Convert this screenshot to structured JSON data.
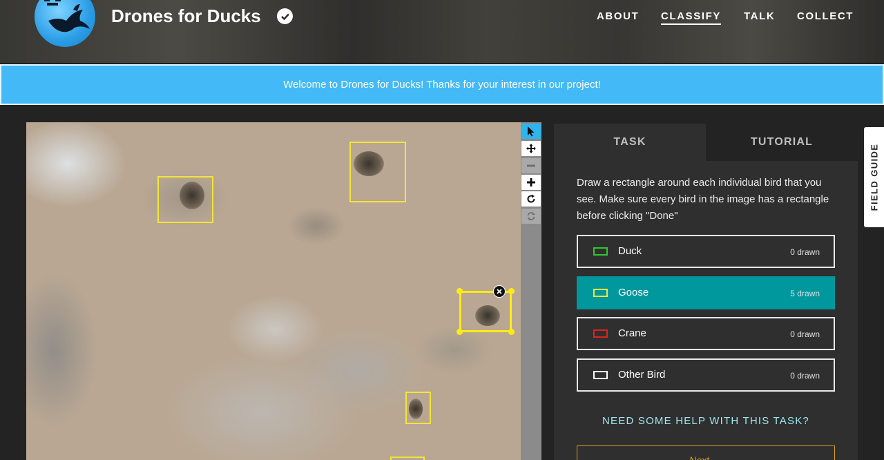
{
  "header": {
    "project_title": "Drones for Ducks",
    "verified_icon": "check-badge-icon",
    "nav": [
      {
        "label": "ABOUT"
      },
      {
        "label": "CLASSIFY",
        "active": true
      },
      {
        "label": "TALK"
      },
      {
        "label": "COLLECT"
      }
    ]
  },
  "banner": {
    "text": "Welcome to Drones for Ducks! Thanks for your interest in our project!"
  },
  "toolbar": {
    "tools": [
      "pointer-icon",
      "pan-icon",
      "zoom-out-icon",
      "zoom-in-icon",
      "rotate-icon",
      "reset-icon"
    ]
  },
  "task_panel": {
    "tabs": [
      {
        "label": "TASK"
      },
      {
        "label": "TUTORIAL"
      }
    ],
    "instruction": "Draw a rectangle around each individual bird that you see. Make sure every bird in the image has a rectangle before clicking \"Done\"",
    "choices": [
      {
        "label": "Duck",
        "count": "0 drawn",
        "color": "#2ec82e"
      },
      {
        "label": "Goose",
        "count": "5 drawn",
        "color": "#f3e53a",
        "active": true
      },
      {
        "label": "Crane",
        "count": "0 drawn",
        "color": "#e0221e"
      },
      {
        "label": "Other Bird",
        "count": "0 drawn",
        "color": "#ffffff"
      }
    ],
    "help_link": "NEED SOME HELP WITH THIS TASK?",
    "next_button": "Next →"
  },
  "field_guide": {
    "label": "FIELD GUIDE"
  },
  "colors": {
    "banner": "#43b9f7",
    "active_choice": "#00979d",
    "box": "#f3e53a",
    "help_link": "#9ee7f0",
    "next_border": "#d9a22a"
  }
}
